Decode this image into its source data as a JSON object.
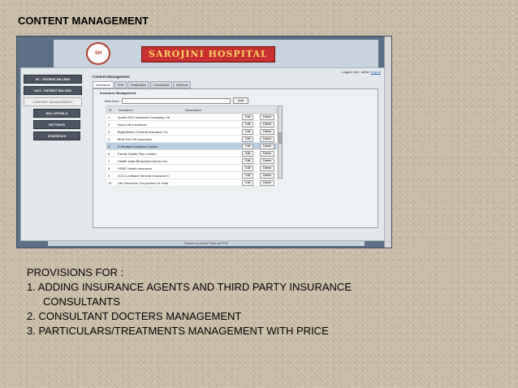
{
  "slide": {
    "title": "CONTENT MANAGEMENT"
  },
  "app": {
    "hospital_name": "SAROJINI HOSPITAL",
    "logo_text": "SH",
    "logged_user": "Logged user: admin",
    "logout": "Logout",
    "sidebar": [
      {
        "label": "IN – PATIENT BILLING",
        "style": "dark"
      },
      {
        "label": "OUT - PATIENT BILLING",
        "style": "dark"
      },
      {
        "label": "CONTENT MANAGEMENT",
        "style": "light"
      },
      {
        "label": "BILL DETAILS",
        "style": "dark"
      },
      {
        "label": "SETTINGS",
        "style": "dark"
      },
      {
        "label": "STATISTICS",
        "style": "dark"
      }
    ],
    "content_title": "Content Management",
    "tabs": [
      "Insurance",
      "TPA",
      "Particulars",
      "Consultant",
      "Referral"
    ],
    "panel_title": "Insurance Management",
    "new_item_label": "New Item:",
    "add_label": "Add",
    "columns": [
      "ID",
      "Insurance",
      "Description"
    ],
    "edit_label": "Edit",
    "delete_label": "Delete",
    "rows": [
      {
        "id": "1",
        "name": "Apollo DKV Insurance Company Ltd"
      },
      {
        "id": "2",
        "name": "Aviva Life Insurance"
      },
      {
        "id": "3",
        "name": "Bajaj Allianz General Insurance Co"
      },
      {
        "id": "4",
        "name": "Birla Sun Life Insurance"
      },
      {
        "id": "5",
        "name": "E-Meditek Solutions Limited"
      },
      {
        "id": "6",
        "name": "Family Health Plan Limited"
      },
      {
        "id": "7",
        "name": "Health India-Bhaichand Amolul Ins"
      },
      {
        "id": "8",
        "name": "HSBC Health Insurance"
      },
      {
        "id": "9",
        "name": "ICICI Lombard General Insurance C"
      },
      {
        "id": "10",
        "name": "Life Insurance Corporation Of India"
      }
    ],
    "selected_row": 4,
    "footer": "Powered by Imonie Flash and PHP"
  },
  "notes": {
    "heading": "PROVISIONS FOR :",
    "items": [
      "1.  ADDING INSURANCE AGENTS AND THIRD PARTY INSURANCE",
      "CONSULTANTS",
      "2. CONSULTANT DOCTERS MANAGEMENT",
      "3. PARTICULARS/TREATMENTS MANAGEMENT WITH PRICE"
    ]
  },
  "colors": {
    "sidebar_dark": "#4c5561",
    "banner_red": "#c92f2f",
    "background": "#cbbfa8"
  }
}
